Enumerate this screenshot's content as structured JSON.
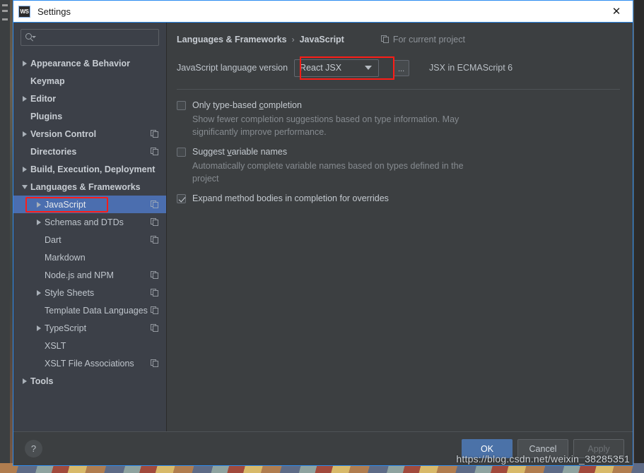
{
  "window": {
    "title": "Settings",
    "app_icon": "WS",
    "close_icon": "✕"
  },
  "sidebar": {
    "search": {
      "value": "",
      "placeholder": ""
    },
    "items": [
      {
        "label": "Appearance & Behavior",
        "arrow": "right",
        "bold": true,
        "indent": 0,
        "scope": false,
        "selected": false
      },
      {
        "label": "Keymap",
        "arrow": "none",
        "bold": true,
        "indent": 0,
        "scope": false,
        "selected": false
      },
      {
        "label": "Editor",
        "arrow": "right",
        "bold": true,
        "indent": 0,
        "scope": false,
        "selected": false
      },
      {
        "label": "Plugins",
        "arrow": "none",
        "bold": true,
        "indent": 0,
        "scope": false,
        "selected": false
      },
      {
        "label": "Version Control",
        "arrow": "right",
        "bold": true,
        "indent": 0,
        "scope": true,
        "selected": false
      },
      {
        "label": "Directories",
        "arrow": "none",
        "bold": true,
        "indent": 0,
        "scope": true,
        "selected": false
      },
      {
        "label": "Build, Execution, Deployment",
        "arrow": "right",
        "bold": true,
        "indent": 0,
        "scope": false,
        "selected": false
      },
      {
        "label": "Languages & Frameworks",
        "arrow": "down",
        "bold": true,
        "indent": 0,
        "scope": false,
        "selected": false
      },
      {
        "label": "JavaScript",
        "arrow": "right",
        "bold": false,
        "indent": 1,
        "scope": true,
        "selected": true
      },
      {
        "label": "Schemas and DTDs",
        "arrow": "right",
        "bold": false,
        "indent": 1,
        "scope": true,
        "selected": false
      },
      {
        "label": "Dart",
        "arrow": "none",
        "bold": false,
        "indent": 1,
        "scope": true,
        "selected": false
      },
      {
        "label": "Markdown",
        "arrow": "none",
        "bold": false,
        "indent": 1,
        "scope": false,
        "selected": false
      },
      {
        "label": "Node.js and NPM",
        "arrow": "none",
        "bold": false,
        "indent": 1,
        "scope": true,
        "selected": false
      },
      {
        "label": "Style Sheets",
        "arrow": "right",
        "bold": false,
        "indent": 1,
        "scope": true,
        "selected": false
      },
      {
        "label": "Template Data Languages",
        "arrow": "none",
        "bold": false,
        "indent": 1,
        "scope": true,
        "selected": false
      },
      {
        "label": "TypeScript",
        "arrow": "right",
        "bold": false,
        "indent": 1,
        "scope": true,
        "selected": false
      },
      {
        "label": "XSLT",
        "arrow": "none",
        "bold": false,
        "indent": 1,
        "scope": false,
        "selected": false
      },
      {
        "label": "XSLT File Associations",
        "arrow": "none",
        "bold": false,
        "indent": 1,
        "scope": true,
        "selected": false
      },
      {
        "label": "Tools",
        "arrow": "right",
        "bold": true,
        "indent": 0,
        "scope": false,
        "selected": false
      }
    ]
  },
  "main": {
    "breadcrumb": {
      "parent": "Languages & Frameworks",
      "separator": "›",
      "current": "JavaScript"
    },
    "scope_note": "For current project",
    "version": {
      "label": "JavaScript language version",
      "selected": "React JSX",
      "ellipsis_label": "...",
      "note": "JSX in ECMAScript 6"
    },
    "options": [
      {
        "label": "Only type-based completion",
        "mnemonic": "c",
        "checked": false,
        "description": "Show fewer completion suggestions based on type information. May significantly improve performance."
      },
      {
        "label": "Suggest variable names",
        "mnemonic": "v",
        "checked": false,
        "description": "Automatically complete variable names based on types defined in the project"
      },
      {
        "label": "Expand method bodies in completion for overrides",
        "mnemonic": "",
        "checked": true,
        "description": ""
      }
    ]
  },
  "footer": {
    "help_label": "?",
    "ok_label": "OK",
    "cancel_label": "Cancel",
    "apply_label": "Apply"
  },
  "watermark": "https://blog.csdn.net/weixin_38285351",
  "colors": {
    "accent_selection": "#4b6eaf",
    "highlight_red": "#fe1d17",
    "dialog_border": "#2d8cf0",
    "sidebar_bg": "#3c4048",
    "panel_bg": "#3c3f41",
    "primary_button": "#4b72a8"
  }
}
